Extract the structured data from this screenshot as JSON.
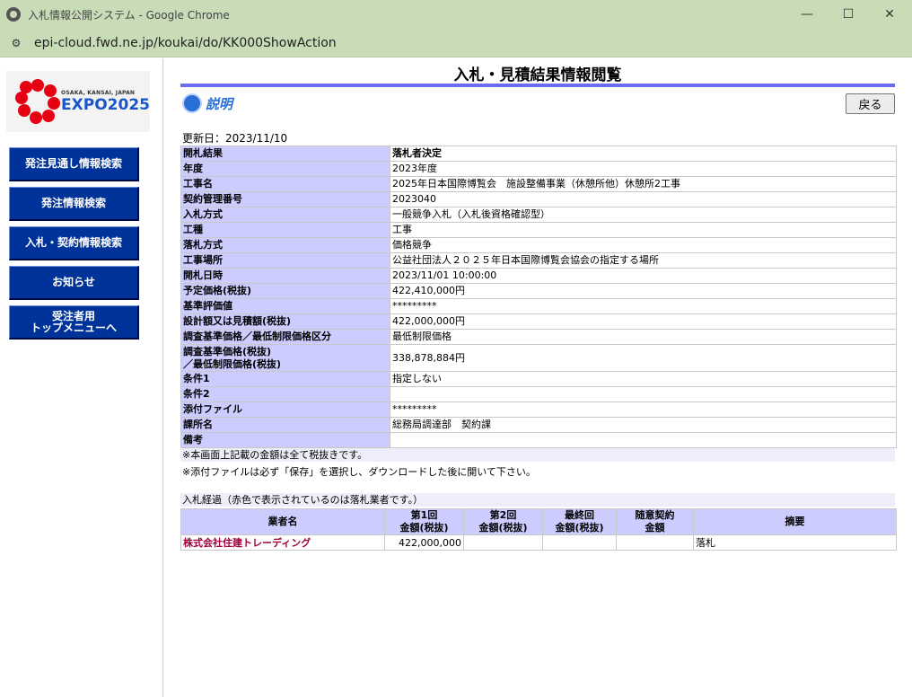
{
  "window": {
    "title": "入札情報公開システム - Google Chrome",
    "url": "epi-cloud.fwd.ne.jp/koukai/do/KK000ShowAction",
    "controls": {
      "minimize": "—",
      "maximize": "☐",
      "close": "✕"
    }
  },
  "logo": {
    "small_text": "OSAKA, KANSAI, JAPAN",
    "big_text": "EXPO2025"
  },
  "sidebar": {
    "buttons": [
      {
        "label": "発注見通し情報検索"
      },
      {
        "label": "発注情報検索"
      },
      {
        "label": "入札・契約情報検索"
      },
      {
        "label": "お知らせ"
      },
      {
        "label_line1": "受注者用",
        "label_line2": "トップメニューへ"
      }
    ]
  },
  "page": {
    "title": "入札・見積結果情報閲覧",
    "help_label": "説明",
    "back_label": "戻る",
    "updated": "更新日：2023/11/10"
  },
  "info_rows": [
    {
      "label": "開札結果",
      "value": "落札者決定"
    },
    {
      "label": "年度",
      "value": "2023年度"
    },
    {
      "label": "工事名",
      "value": "2025年日本国際博覧会　施設整備事業（休憩所他）休憩所2工事"
    },
    {
      "label": "契約管理番号",
      "value": "2023040"
    },
    {
      "label": "入札方式",
      "value": "一般競争入札（入札後資格確認型）"
    },
    {
      "label": "工種",
      "value": "工事"
    },
    {
      "label": "落札方式",
      "value": "価格競争"
    },
    {
      "label": "工事場所",
      "value": "公益社団法人２０２５年日本国際博覧会協会の指定する場所"
    },
    {
      "label": "開札日時",
      "value": "2023/11/01 10:00:00"
    },
    {
      "label": "予定価格(税抜)",
      "value": "422,410,000円"
    },
    {
      "label": "基準評価値",
      "value": "*********"
    },
    {
      "label": "設計額又は見積額(税抜)",
      "value": "422,000,000円"
    },
    {
      "label": "調査基準価格／最低制限価格区分",
      "value": "最低制限価格"
    },
    {
      "label_line1": "調査基準価格(税抜)",
      "label_line2": "／最低制限価格(税抜)",
      "value": "338,878,884円"
    },
    {
      "label": "条件1",
      "value": "指定しない"
    },
    {
      "label": "条件2",
      "value": ""
    },
    {
      "label": "添付ファイル",
      "value": "*********"
    },
    {
      "label": "課所名",
      "value": "総務局調達部　契約課"
    },
    {
      "label": "備考",
      "value": ""
    }
  ],
  "notes": {
    "note1": "※本画面上記載の金額は全て税抜きです。",
    "note2": "※添付ファイルは必ず「保存」を選択し、ダウンロードした後に開いて下さい。"
  },
  "bids": {
    "section_title": "入札経過（赤色で表示されているのは落札業者です。）",
    "headers": {
      "company": "業者名",
      "round1_l1": "第1回",
      "round1_l2": "金額(税抜)",
      "round2_l1": "第2回",
      "round2_l2": "金額(税抜)",
      "final_l1": "最終回",
      "final_l2": "金額(税抜)",
      "negotiated_l1": "随意契約",
      "negotiated_l2": "金額",
      "summary": "摘要"
    },
    "rows": [
      {
        "company": "株式会社住建トレーディング",
        "round1": "422,000,000",
        "round2": "",
        "final": "",
        "negotiated": "",
        "summary": "落札"
      }
    ]
  }
}
